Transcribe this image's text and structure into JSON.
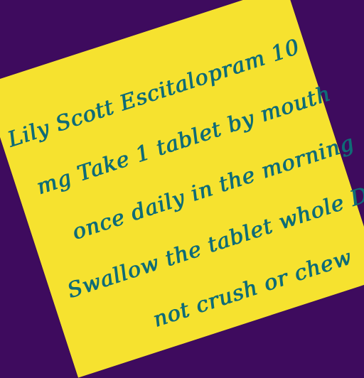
{
  "note": {
    "background_color": "#f6e22f",
    "page_background": "#3e0b5e",
    "text_color": "#0f6a79",
    "lines": [
      "Lily Scott Escitalopram 10",
      "mg Take 1 tablet by mouth",
      "once daily in the morning",
      "Swallow the tablet whole Do",
      "not crush or chew"
    ]
  }
}
